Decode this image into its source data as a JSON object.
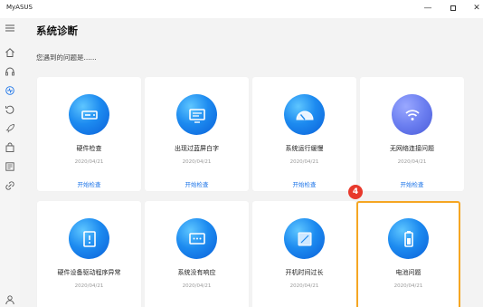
{
  "window": {
    "title": "MyASUS",
    "minimize": "—",
    "close": "✕"
  },
  "sidebar": {
    "items": [
      {
        "icon": "menu-icon"
      },
      {
        "icon": "home-icon"
      },
      {
        "icon": "headset-icon"
      },
      {
        "icon": "diagnostics-icon",
        "active": true
      },
      {
        "icon": "recovery-icon"
      },
      {
        "icon": "rocket-icon"
      },
      {
        "icon": "bag-icon"
      },
      {
        "icon": "news-icon"
      },
      {
        "icon": "link-icon"
      },
      {
        "icon": "user-icon"
      }
    ]
  },
  "main": {
    "title": "系统诊断",
    "subtitle": "您遇到的问题是......"
  },
  "cards": [
    {
      "label": "硬件检查",
      "date": "2020/04/21",
      "action": "开始检查",
      "icon": "hardware-check-icon"
    },
    {
      "label": "出现过蓝屏白字",
      "date": "2020/04/21",
      "action": "开始检查",
      "icon": "blue-screen-icon"
    },
    {
      "label": "系统运行缓慢",
      "date": "2020/04/21",
      "action": "开始检查",
      "icon": "speedometer-icon"
    },
    {
      "label": "无网络连接问题",
      "date": "2020/04/21",
      "action": "开始检查",
      "icon": "wifi-icon"
    },
    {
      "label": "硬件设备驱动程序异常",
      "date": "2020/04/21",
      "icon": "driver-icon"
    },
    {
      "label": "系统没有响应",
      "date": "2020/04/21",
      "icon": "no-response-icon"
    },
    {
      "label": "开机时间过长",
      "date": "2020/04/21",
      "icon": "boot-time-icon"
    },
    {
      "label": "电池问题",
      "date": "2020/04/21",
      "icon": "battery-icon"
    }
  ],
  "annotation": {
    "step": "4"
  },
  "colors": {
    "accent": "#1a73e8",
    "highlight_border": "#f5a623",
    "badge": "#e8392c"
  }
}
